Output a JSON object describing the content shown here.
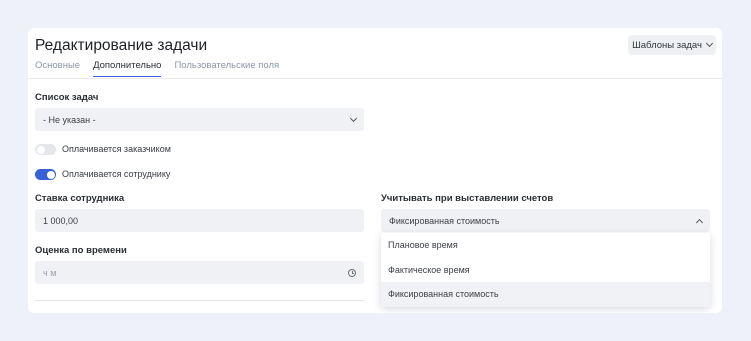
{
  "header": {
    "title": "Редактирование задачи",
    "templates_button": "Шаблоны задач"
  },
  "tabs": [
    {
      "label": "Основные",
      "active": false
    },
    {
      "label": "Дополнительно",
      "active": true
    },
    {
      "label": "Пользовательские поля",
      "active": false
    }
  ],
  "task_list": {
    "label": "Список задач",
    "value": "- Не указан -"
  },
  "toggles": {
    "paid_by_client": {
      "label": "Оплачивается заказчиком",
      "on": false
    },
    "paid_to_employee": {
      "label": "Оплачивается сотруднику",
      "on": true
    }
  },
  "rate": {
    "label": "Ставка сотрудника",
    "value": "1 000,00"
  },
  "billing": {
    "label": "Учитывать при выставлении счетов",
    "value": "Фиксированная стоимость",
    "options": [
      "Плановое время",
      "Фактическое время",
      "Фиксированная стоимость"
    ],
    "selected_index": 2
  },
  "time_estimate": {
    "label": "Оценка по времени",
    "placeholder": "ч м"
  },
  "colors": {
    "accent": "#3560d6",
    "background": "#eef1fa"
  }
}
